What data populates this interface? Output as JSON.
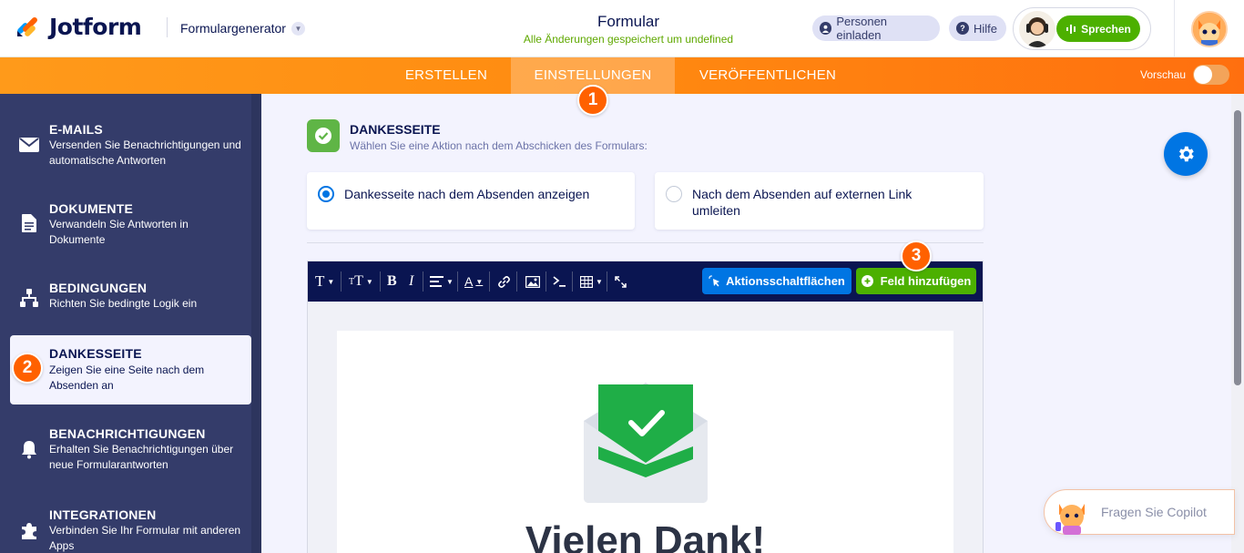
{
  "header": {
    "logo_text": "Jotform",
    "formgen_label": "Formulargenerator",
    "form_title": "Formular",
    "save_status": "Alle Änderungen gespeichert um undefined",
    "invite_label": "Personen einladen",
    "help_label": "Hilfe",
    "speak_label": "Sprechen"
  },
  "nav": {
    "tabs": [
      {
        "label": "ERSTELLEN",
        "active": false
      },
      {
        "label": "EINSTELLUNGEN",
        "active": true
      },
      {
        "label": "VERÖFFENTLICHEN",
        "active": false
      }
    ],
    "preview_label": "Vorschau",
    "preview_on": false
  },
  "badges": [
    "1",
    "2",
    "3"
  ],
  "sidebar": {
    "items": [
      {
        "title": "E-MAILS",
        "desc": "Versenden Sie Benachrichtigungen und automatische Antworten",
        "icon": "envelope-icon"
      },
      {
        "title": "DOKUMENTE",
        "desc": "Verwandeln Sie Antworten in Dokumente",
        "icon": "document-icon"
      },
      {
        "title": "BEDINGUNGEN",
        "desc": "Richten Sie bedingte Logik ein",
        "icon": "conditions-icon"
      },
      {
        "title": "DANKESSEITE",
        "desc": "Zeigen Sie eine Seite nach dem Absenden an",
        "icon": "thankyou-icon",
        "active": true
      },
      {
        "title": "BENACHRICHTIGUNGEN",
        "desc": "Erhalten Sie Benachrichtigungen über neue Formularantworten",
        "icon": "bell-icon"
      },
      {
        "title": "INTEGRATIONEN",
        "desc": "Verbinden Sie Ihr Formular mit anderen Apps",
        "icon": "puzzle-icon"
      }
    ]
  },
  "main": {
    "section_title": "DANKESSEITE",
    "section_subtitle": "Wählen Sie eine Aktion nach dem Abschicken des Formulars:",
    "options": [
      {
        "label": "Dankesseite nach dem Absenden anzeigen",
        "selected": true
      },
      {
        "label": "Nach dem Absenden auf externen Link umleiten",
        "selected": false
      }
    ],
    "toolbar": {
      "action_buttons_label": "Aktionsschaltflächen",
      "add_field_label": "Feld hinzufügen"
    },
    "thank_you_heading": "Vielen Dank!"
  },
  "copilot": {
    "label": "Fragen Sie Copilot"
  },
  "colors": {
    "brand_orange": "#ff6100",
    "nav_gradient_start": "#ff9a1a",
    "sidebar_bg": "#343c6a",
    "primary_blue": "#0075e3",
    "success_green": "#4cb000",
    "toolbar_bg": "#0a1551"
  }
}
